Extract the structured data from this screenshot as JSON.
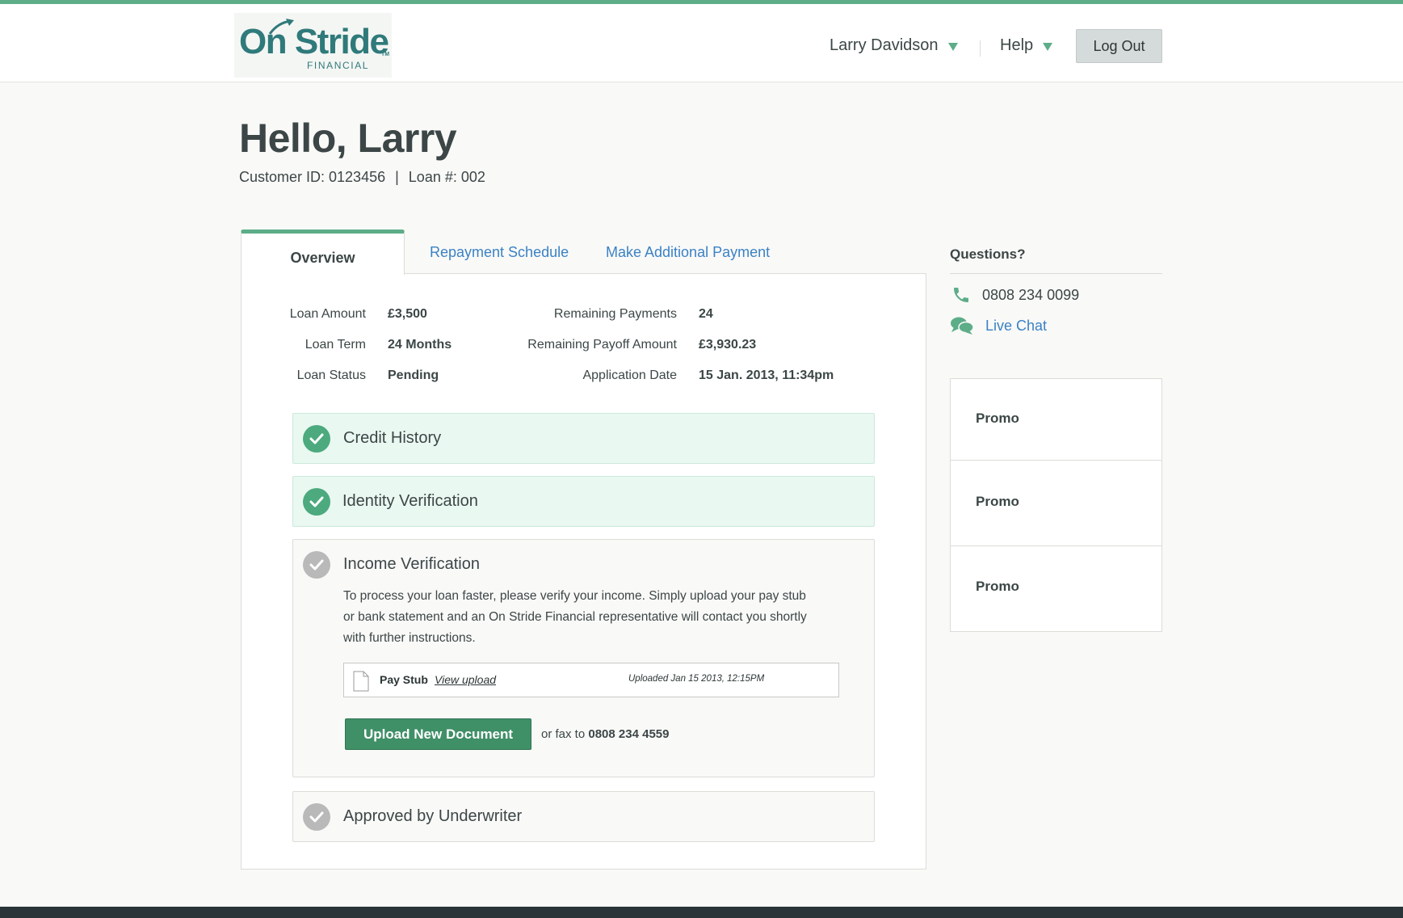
{
  "colors": {
    "accent": "#5cad88",
    "link": "#3b82c4",
    "button": "#3f8f67",
    "footer": "#2a3439"
  },
  "header": {
    "logo": {
      "main": "On Stride",
      "sub": "FINANCIAL",
      "tm": "TM"
    },
    "user_menu": "Larry Davidson",
    "help_menu": "Help",
    "logout": "Log Out"
  },
  "greeting": "Hello, Larry",
  "customer": {
    "id_text": "Customer ID: 0123456",
    "sep": "|",
    "loan_text": "Loan #: 002"
  },
  "tabs": [
    "Overview",
    "Repayment Schedule",
    "Make Additional Payment"
  ],
  "summary": {
    "left": [
      {
        "label": "Loan Amount",
        "value": "£3,500"
      },
      {
        "label": "Loan Term",
        "value": "24 Months"
      },
      {
        "label": "Loan Status",
        "value": "Pending"
      }
    ],
    "right": [
      {
        "label": "Remaining Payments",
        "value": "24"
      },
      {
        "label": "Remaining Payoff Amount",
        "value": "£3,930.23"
      },
      {
        "label": "Application Date",
        "value": "15 Jan. 2013, 11:34pm"
      }
    ]
  },
  "steps": [
    {
      "title": "Credit History",
      "status": "complete"
    },
    {
      "title": "Identity Verification",
      "status": "complete"
    },
    {
      "title": "Income Verification",
      "status": "pending",
      "description": "To process your loan faster, please verify your income. Simply upload your pay stub or bank statement and an On Stride Financial representative will contact you shortly with further instructions.",
      "file": {
        "name": "Pay Stub",
        "view_link": "View upload",
        "uploaded": "Uploaded Jan 15 2013, 12:15PM",
        "icon": "document-icon"
      },
      "upload_button": "Upload New Document",
      "fax_prefix": "or fax to",
      "fax_number": "0808 234 4559"
    },
    {
      "title": "Approved by Underwriter",
      "status": "pending"
    }
  ],
  "sidebar": {
    "title": "Questions?",
    "phone": {
      "icon": "phone-icon",
      "number": "0808 234 0099"
    },
    "chat": {
      "icon": "chat-icon",
      "label": "Live Chat"
    },
    "promos": [
      "Promo",
      "Promo",
      "Promo"
    ]
  }
}
